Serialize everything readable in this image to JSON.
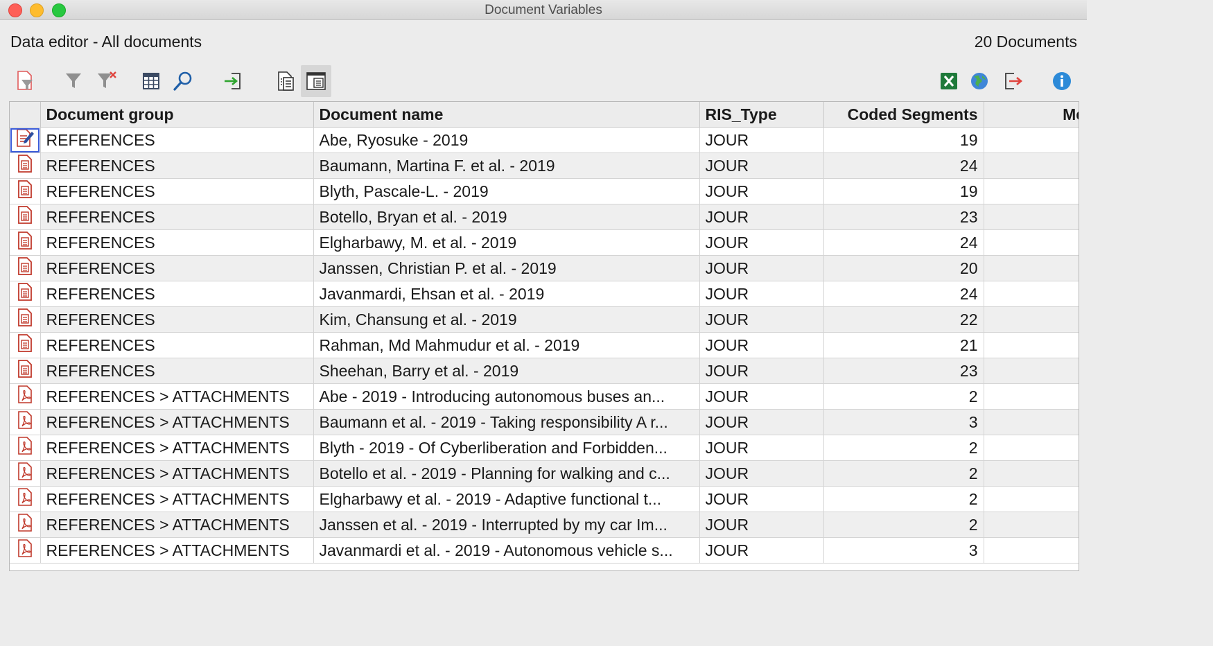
{
  "window": {
    "title": "Document Variables"
  },
  "header": {
    "left": "Data editor - All documents",
    "right": "20 Documents"
  },
  "toolbar": {
    "left_icons": [
      "document-filter-icon",
      "filter-icon",
      "clear-filter-icon",
      "columns-icon",
      "search-icon",
      "import-icon",
      "document-list-icon",
      "document-view-icon"
    ],
    "right_icons": [
      "excel-export-icon",
      "web-export-icon",
      "export-icon",
      "info-icon"
    ]
  },
  "table": {
    "columns": [
      "Document group",
      "Document name",
      "RIS_Type",
      "Coded Segments",
      "Mem"
    ],
    "rows": [
      {
        "icon": "edit-document-icon",
        "group": "REFERENCES",
        "name": "Abe, Ryosuke - 2019",
        "type": "JOUR",
        "coded": "19"
      },
      {
        "icon": "text-document-icon",
        "group": "REFERENCES",
        "name": "Baumann, Martina F. et al. - 2019",
        "type": "JOUR",
        "coded": "24"
      },
      {
        "icon": "text-document-icon",
        "group": "REFERENCES",
        "name": "Blyth, Pascale-L. - 2019",
        "type": "JOUR",
        "coded": "19"
      },
      {
        "icon": "text-document-icon",
        "group": "REFERENCES",
        "name": "Botello, Bryan et al. - 2019",
        "type": "JOUR",
        "coded": "23"
      },
      {
        "icon": "text-document-icon",
        "group": "REFERENCES",
        "name": "Elgharbawy, M. et al. - 2019",
        "type": "JOUR",
        "coded": "24"
      },
      {
        "icon": "text-document-icon",
        "group": "REFERENCES",
        "name": "Janssen, Christian P. et al. - 2019",
        "type": "JOUR",
        "coded": "20"
      },
      {
        "icon": "text-document-icon",
        "group": "REFERENCES",
        "name": "Javanmardi, Ehsan et al. - 2019",
        "type": "JOUR",
        "coded": "24"
      },
      {
        "icon": "text-document-icon",
        "group": "REFERENCES",
        "name": "Kim, Chansung et al. - 2019",
        "type": "JOUR",
        "coded": "22"
      },
      {
        "icon": "text-document-icon",
        "group": "REFERENCES",
        "name": "Rahman, Md Mahmudur et al. - 2019",
        "type": "JOUR",
        "coded": "21"
      },
      {
        "icon": "text-document-icon",
        "group": "REFERENCES",
        "name": "Sheehan, Barry et al. - 2019",
        "type": "JOUR",
        "coded": "23"
      },
      {
        "icon": "pdf-document-icon",
        "group": "REFERENCES > ATTACHMENTS",
        "name": "Abe - 2019 - Introducing autonomous buses an...",
        "type": "JOUR",
        "coded": "2"
      },
      {
        "icon": "pdf-document-icon",
        "group": "REFERENCES > ATTACHMENTS",
        "name": "Baumann et al. - 2019 - Taking responsibility A r...",
        "type": "JOUR",
        "coded": "3"
      },
      {
        "icon": "pdf-document-icon",
        "group": "REFERENCES > ATTACHMENTS",
        "name": "Blyth - 2019 - Of Cyberliberation and Forbidden...",
        "type": "JOUR",
        "coded": "2"
      },
      {
        "icon": "pdf-document-icon",
        "group": "REFERENCES > ATTACHMENTS",
        "name": "Botello et al. - 2019 - Planning for walking and c...",
        "type": "JOUR",
        "coded": "2"
      },
      {
        "icon": "pdf-document-icon",
        "group": "REFERENCES > ATTACHMENTS",
        "name": "Elgharbawy et al. - 2019 - Adaptive functional t...",
        "type": "JOUR",
        "coded": "2"
      },
      {
        "icon": "pdf-document-icon",
        "group": "REFERENCES > ATTACHMENTS",
        "name": "Janssen et al. - 2019 - Interrupted by my car Im...",
        "type": "JOUR",
        "coded": "2"
      },
      {
        "icon": "pdf-document-icon",
        "group": "REFERENCES > ATTACHMENTS",
        "name": "Javanmardi et al. - 2019 - Autonomous vehicle s...",
        "type": "JOUR",
        "coded": "3"
      }
    ]
  }
}
